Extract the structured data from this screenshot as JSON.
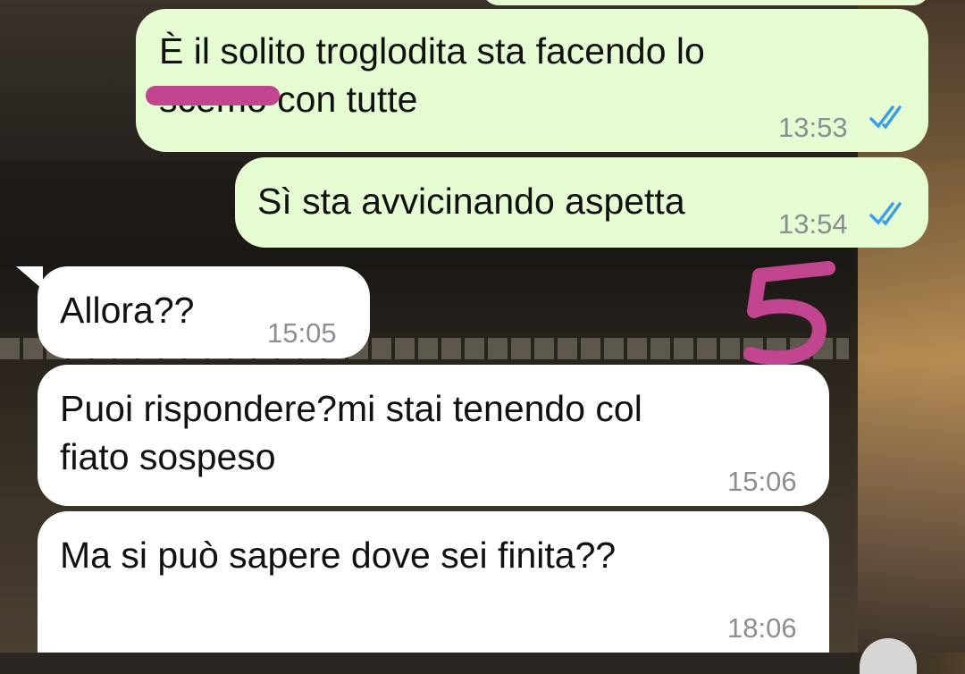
{
  "messages": [
    {
      "direction": "outgoing",
      "text": "È il solito troglodita sta facendo lo\nscemo con tutte",
      "time": "13:53",
      "status": "read-double-tick"
    },
    {
      "direction": "outgoing",
      "text": "Sì sta avvicinando aspetta",
      "time": "13:54",
      "status": "read-double-tick"
    },
    {
      "direction": "incoming",
      "text": "Allora??",
      "time": "15:05"
    },
    {
      "direction": "incoming",
      "text": "Puoi rispondere?mi stai tenendo col\nfiato sospeso",
      "time": "15:06"
    },
    {
      "direction": "incoming",
      "text": "Ma si può sapere dove sei finita??",
      "time": "18:06"
    }
  ],
  "annotation": {
    "handwritten_number": "5",
    "color": "#c2458f"
  },
  "colors": {
    "outgoing_bubble": "#e6fcd2",
    "incoming_bubble": "#ffffff",
    "tick_blue": "#3b9ee6",
    "time_gray": "#8a8f93"
  }
}
